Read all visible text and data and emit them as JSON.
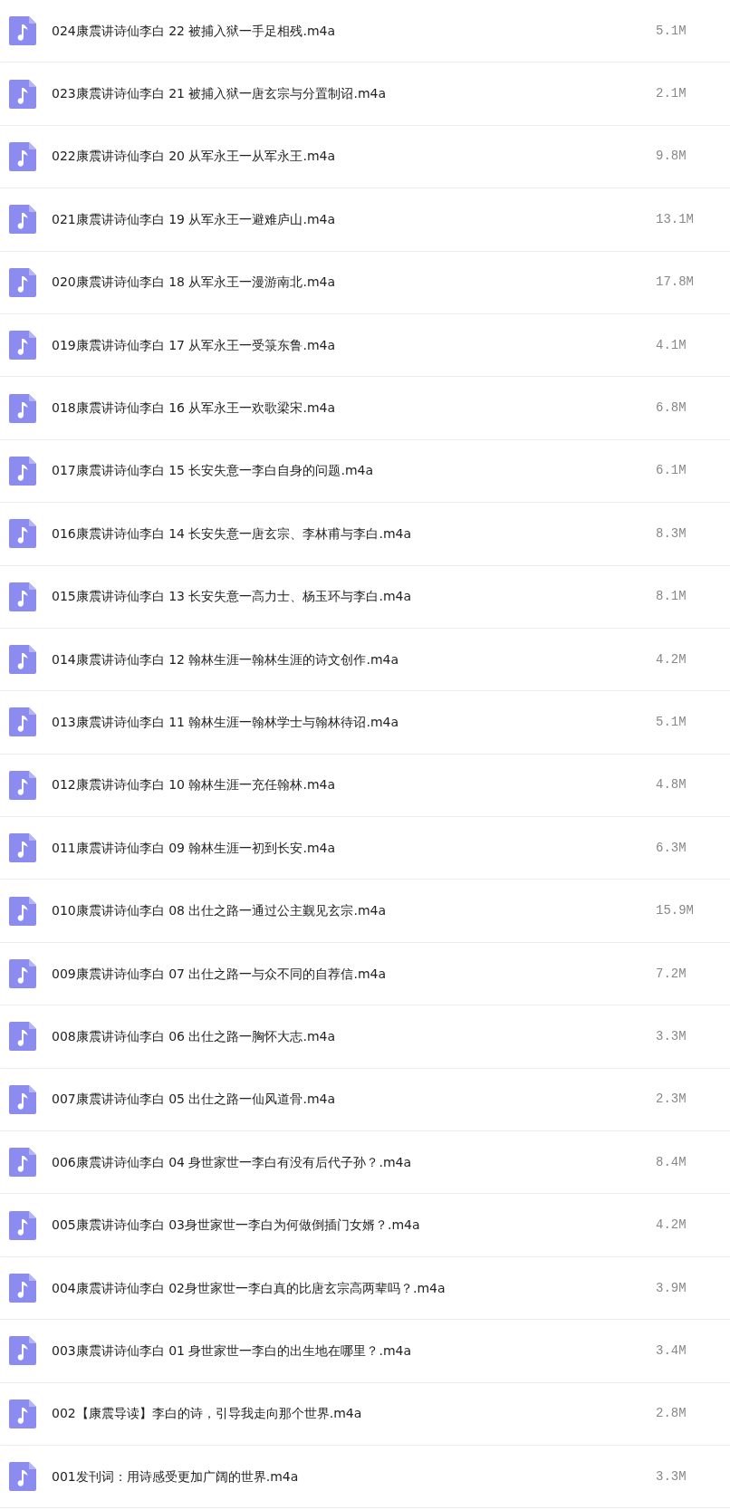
{
  "files": [
    {
      "name": "024康震讲诗仙李白 22 被捕入狱一手足相残.m4a",
      "size": "5.1M"
    },
    {
      "name": "023康震讲诗仙李白 21 被捕入狱一唐玄宗与分置制诏.m4a",
      "size": "2.1M"
    },
    {
      "name": "022康震讲诗仙李白 20 从军永王一从军永王.m4a",
      "size": "9.8M"
    },
    {
      "name": "021康震讲诗仙李白 19 从军永王一避难庐山.m4a",
      "size": "13.1M"
    },
    {
      "name": "020康震讲诗仙李白 18 从军永王一漫游南北.m4a",
      "size": "17.8M"
    },
    {
      "name": "019康震讲诗仙李白 17 从军永王一受箓东鲁.m4a",
      "size": "4.1M"
    },
    {
      "name": "018康震讲诗仙李白 16 从军永王一欢歌梁宋.m4a",
      "size": "6.8M"
    },
    {
      "name": "017康震讲诗仙李白 15 长安失意一李白自身的问题.m4a",
      "size": "6.1M"
    },
    {
      "name": "016康震讲诗仙李白 14 长安失意一唐玄宗、李林甫与李白.m4a",
      "size": "8.3M"
    },
    {
      "name": "015康震讲诗仙李白 13 长安失意一高力士、杨玉环与李白.m4a",
      "size": "8.1M"
    },
    {
      "name": "014康震讲诗仙李白 12 翰林生涯一翰林生涯的诗文创作.m4a",
      "size": "4.2M"
    },
    {
      "name": "013康震讲诗仙李白 11 翰林生涯一翰林学士与翰林待诏.m4a",
      "size": "5.1M"
    },
    {
      "name": "012康震讲诗仙李白 10 翰林生涯一充任翰林.m4a",
      "size": "4.8M"
    },
    {
      "name": "011康震讲诗仙李白 09 翰林生涯一初到长安.m4a",
      "size": "6.3M"
    },
    {
      "name": "010康震讲诗仙李白 08 出仕之路一通过公主觐见玄宗.m4a",
      "size": "15.9M"
    },
    {
      "name": "009康震讲诗仙李白 07 出仕之路一与众不同的自荐信.m4a",
      "size": "7.2M"
    },
    {
      "name": "008康震讲诗仙李白 06 出仕之路一胸怀大志.m4a",
      "size": "3.3M"
    },
    {
      "name": "007康震讲诗仙李白 05 出仕之路一仙风道骨.m4a",
      "size": "2.3M"
    },
    {
      "name": "006康震讲诗仙李白 04 身世家世一李白有没有后代子孙？.m4a",
      "size": "8.4M"
    },
    {
      "name": "005康震讲诗仙李白 03身世家世一李白为何做倒插门女婿？.m4a",
      "size": "4.2M"
    },
    {
      "name": "004康震讲诗仙李白 02身世家世一李白真的比唐玄宗高两辈吗？.m4a",
      "size": "3.9M"
    },
    {
      "name": "003康震讲诗仙李白 01 身世家世一李白的出生地在哪里？.m4a",
      "size": "3.4M"
    },
    {
      "name": "002【康震导读】李白的诗，引导我走向那个世界.m4a",
      "size": "2.8M"
    },
    {
      "name": "001发刊词：用诗感受更加广阔的世界.m4a",
      "size": "3.3M"
    }
  ]
}
